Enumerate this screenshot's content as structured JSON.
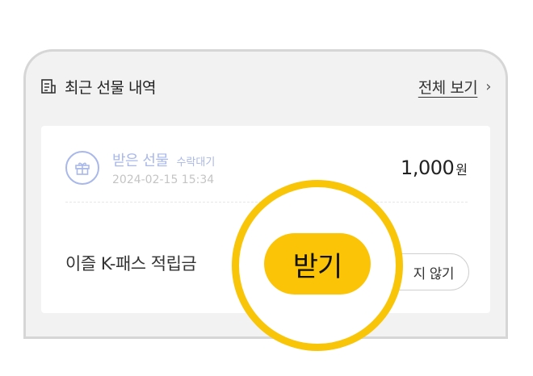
{
  "header": {
    "title": "최근 선물 내역",
    "view_all_label": "전체 보기",
    "chevron": "›"
  },
  "gift": {
    "title": "받은 선물",
    "status": "수락대기",
    "date": "2024-02-15 15:34",
    "amount": "1,000",
    "unit": "원"
  },
  "point": {
    "label": "이즐 K-패스 적립금"
  },
  "buttons": {
    "receive_label": "받기",
    "decline_label": "지 않기"
  },
  "colors": {
    "accent_yellow": "#fbc407",
    "gift_blue": "#a9b8ea"
  },
  "icons": {
    "header_icon": "list-document-icon",
    "gift_icon": "gift-icon",
    "view_all_icon": "chevron-right-icon"
  }
}
